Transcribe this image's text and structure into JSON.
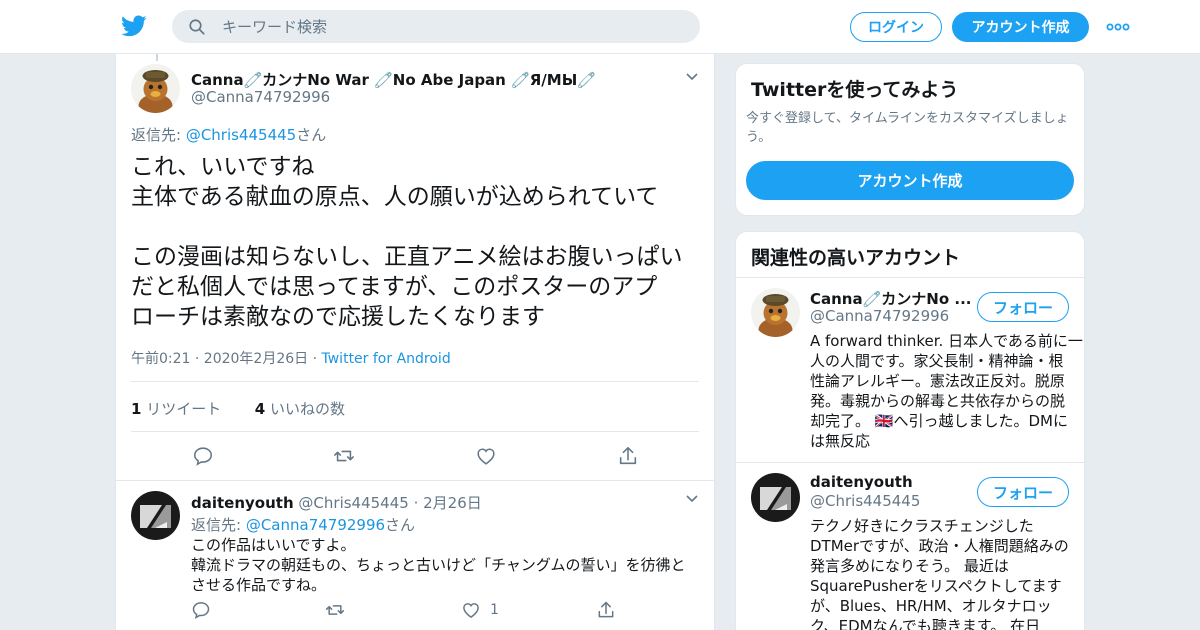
{
  "header": {
    "search_placeholder": "キーワード検索",
    "login_label": "ログイン",
    "signup_label": "アカウント作成"
  },
  "main_tweet": {
    "name": "Canna🧷カンナNo War 🧷No Abe Japan 🧷Я/МЫ🧷",
    "handle": "@Canna74792996",
    "reply_prefix": "返信先: ",
    "reply_to": "@Chris445445",
    "reply_suffix": "さん",
    "text_lines": [
      "これ、いいですね",
      "主体である献血の原点、人の願いが込められていて",
      "",
      "この漫画は知らないし、正直アニメ絵はお腹いっぱい",
      "だと私個人では思ってますが、このポスターのアプ",
      "ローチは素敵なので応援したくなります"
    ],
    "meta_time": "午前0:21 · 2020年2月26日 · ",
    "meta_source": "Twitter for Android",
    "retweet_count": "1",
    "retweet_label": " リツイート",
    "like_count": "4",
    "like_label": " いいねの数"
  },
  "reply_tweet": {
    "name": "daitenyouth",
    "handle": "@Chris445445",
    "date": " · 2月26日",
    "reply_prefix": "返信先: ",
    "reply_to": "@Canna74792996",
    "reply_suffix": "さん",
    "text_lines": [
      "この作品はいいですよ。",
      "韓流ドラマの朝廷もの、ちょっと古いけど「チャングムの誓い」を彷彿と",
      "させる作品ですね。"
    ],
    "like_count": "1"
  },
  "signup_card": {
    "title": "Twitterを使ってみよう",
    "subtitle_lines": [
      "今すぐ登録して、タイムラインをカスタマイズしましょ",
      "う。"
    ],
    "button_label": "アカウント作成"
  },
  "related_card": {
    "title": "関連性の高いアカウント",
    "follow_label": "フォロー",
    "accounts": [
      {
        "name": "Canna🧷カンナNo ...",
        "handle": "@Canna74792996",
        "bio_lines": [
          "A forward thinker. 日本人である前に一",
          "人の人間です。家父長制・精神論・根",
          "性論アレルギー。憲法改正反対。脱原",
          "発。毒親からの解毒と共依存からの脱",
          "却完了。 🇬🇧へ引っ越しました。DMに",
          "は無反応"
        ]
      },
      {
        "name": "daitenyouth",
        "handle": "@Chris445445",
        "bio_lines": [
          "テクノ好きにクラスチェンジした",
          "DTMerですが、政治・人権問題絡みの",
          "発言多めになりそう。 最近は",
          "SquarePusherをリスペクトしてます",
          "が、Blues、HR/HM、オルタナロッ",
          "ク、EDMなんでも聴きます。 在日"
        ]
      }
    ]
  },
  "colors": {
    "accent": "#1da1f2",
    "link": "#1b95e0",
    "muted": "#657786",
    "border": "#e1e8ed"
  }
}
